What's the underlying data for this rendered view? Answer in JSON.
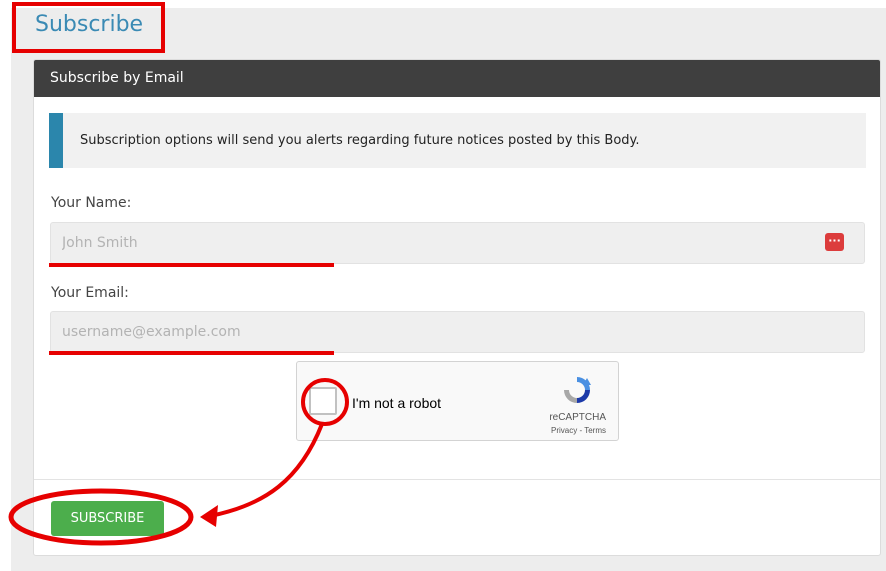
{
  "page": {
    "title": "Subscribe"
  },
  "panel": {
    "header": "Subscribe by Email",
    "notice": "Subscription options will send you alerts regarding future notices posted by this Body."
  },
  "form": {
    "name_label": "Your Name:",
    "name_placeholder": "John Smith",
    "email_label": "Your Email:",
    "email_placeholder": "username@example.com"
  },
  "captcha": {
    "label": "I'm not a robot",
    "brand": "reCAPTCHA",
    "links": "Privacy - Terms"
  },
  "actions": {
    "subscribe_label": "SUBSCRIBE"
  },
  "icons": {
    "password_manager": "password-manager-icon",
    "recaptcha": "recaptcha-logo-icon"
  },
  "colors": {
    "title": "#3a8ab4",
    "header_bg": "#3f3f3f",
    "notice_accent": "#2b86ac",
    "button": "#4cae4c",
    "annotation": "#e60000"
  }
}
